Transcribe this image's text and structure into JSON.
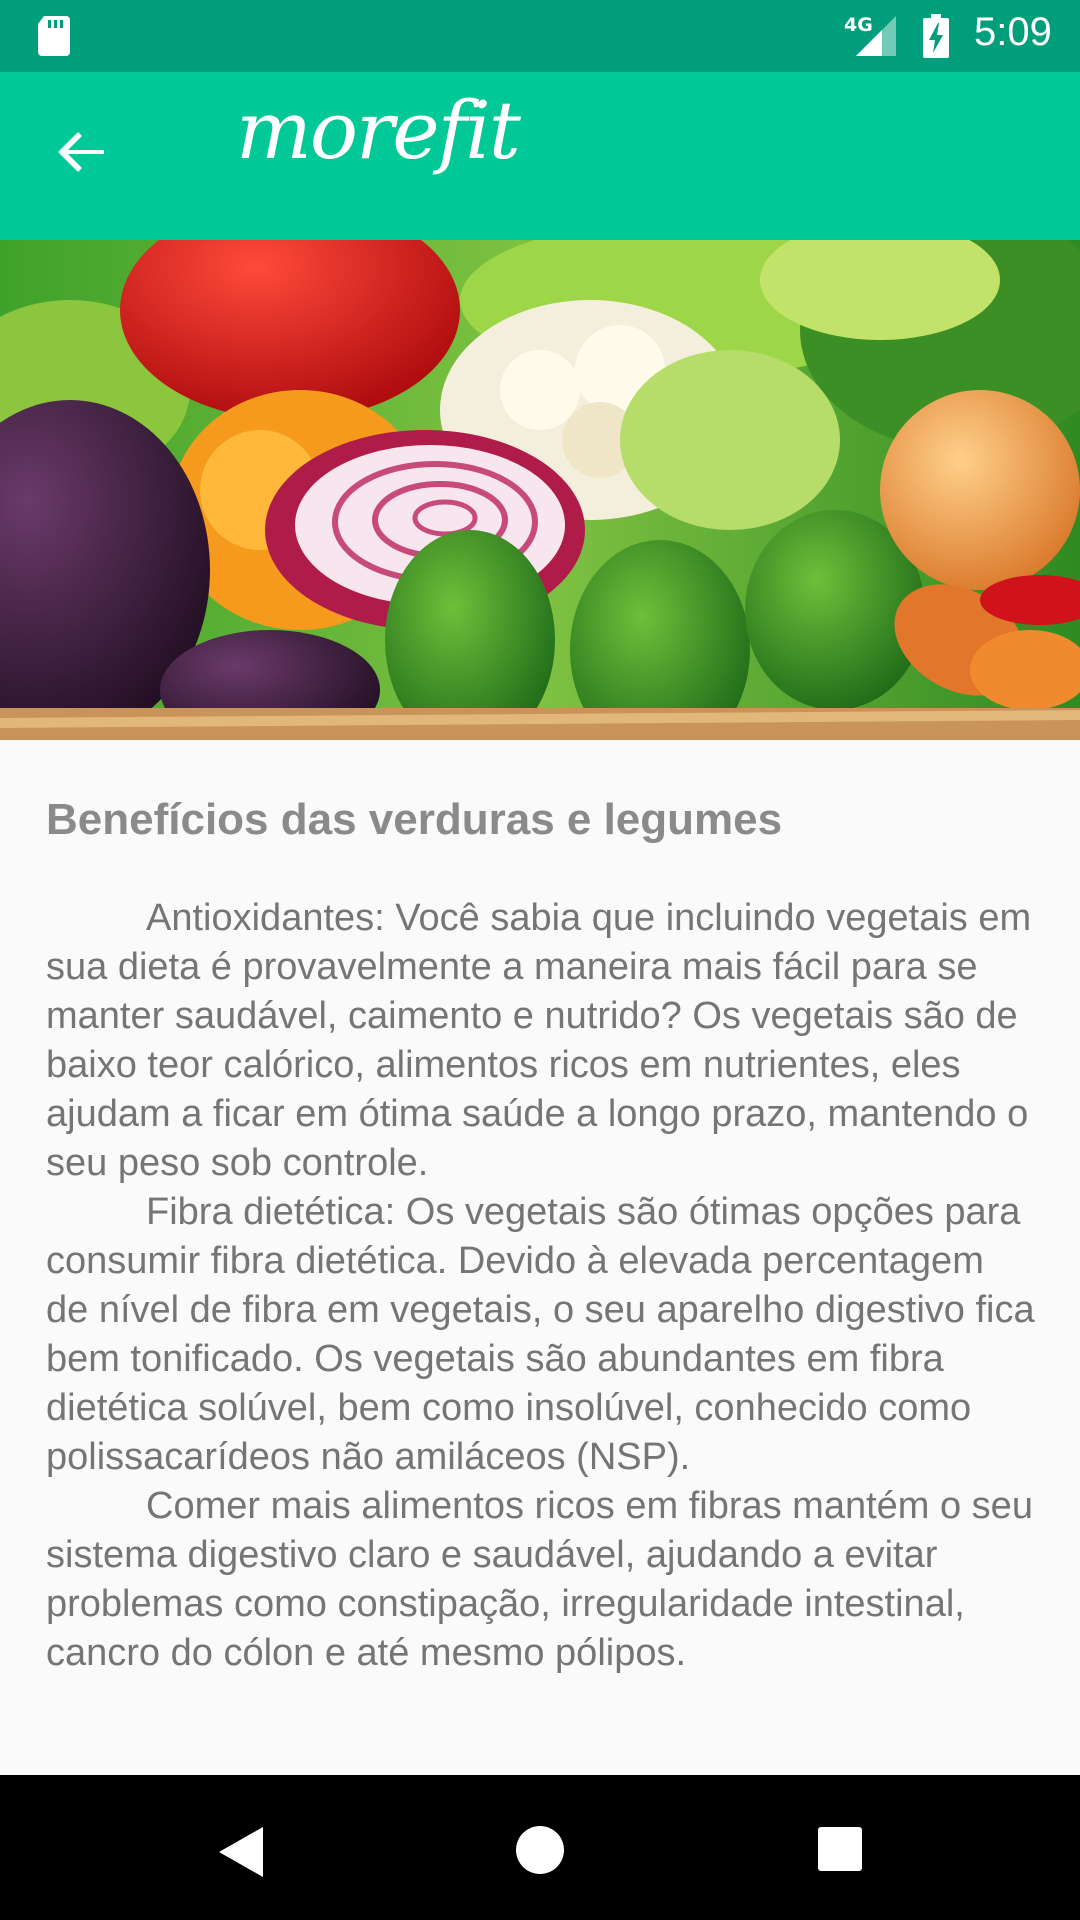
{
  "status_bar": {
    "network_type": "4G",
    "time": "5:09",
    "icons": [
      "sd-card-icon",
      "signal-icon",
      "battery-charging-icon"
    ]
  },
  "app_bar": {
    "brand": "morefit",
    "back_icon": "arrow-back-icon",
    "background": "#00c896"
  },
  "hero_image": {
    "subject": "assorted vegetables: peppers, onions, cucumbers, cauliflower, eggplant, carrots, lettuce"
  },
  "article": {
    "title": "Benefícios das verduras e legumes",
    "paragraphs": [
      "Antioxidantes: Você sabia que incluindo vegetais em sua dieta é provavelmente a maneira mais fácil para se manter saudável, caimento e nutrido? Os vegetais são de baixo teor calórico, alimentos ricos em nutrientes, eles ajudam a ficar em ótima saúde a longo prazo, mantendo o seu peso sob controle.",
      "Fibra dietética: Os vegetais são ótimas opções para consumir fibra dietética. Devido à elevada percentagem de nível de fibra em vegetais, o seu aparelho digestivo fica bem tonificado. Os vegetais são abundantes em fibra dietética solúvel, bem como insolúvel, conhecido como polissacarídeos não amiláceos (NSP).",
      "Comer mais alimentos ricos em fibras mantém o seu sistema digestivo claro e saudável, ajudando a evitar problemas como constipação, irregularidade intestinal, cancro do cólon e até mesmo pólipos."
    ]
  },
  "nav_bar": {
    "buttons": [
      "nav-back-icon",
      "nav-home-icon",
      "nav-recents-icon"
    ]
  },
  "colors": {
    "status_bar": "#009e7a",
    "app_bar": "#00c896",
    "text": "#757575",
    "title": "#8a8a8a"
  }
}
